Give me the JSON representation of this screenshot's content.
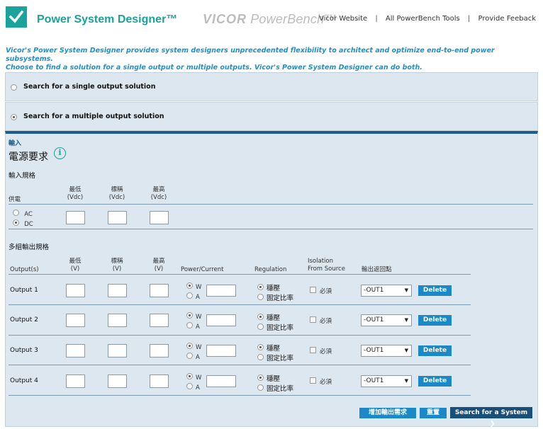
{
  "header": {
    "app_title": "Power System Designer™",
    "brand_logo_main": "VICOR",
    "brand_logo_sub": "PowerBench™",
    "links": [
      "Vicor Website",
      "All PowerBench Tools",
      "Provide Feeback"
    ],
    "separator": "|"
  },
  "intro": {
    "line1": "Vicor's Power System Designer provides system designers unprecedented flexibility to architect and optimize end-to-end power subsystems.",
    "line2": "Choose to find a solution for a single output or multiple outputs. Vicor's Power System Designer can do both."
  },
  "search_options": [
    {
      "label": "Search for a single output solution",
      "selected": false
    },
    {
      "label": "Search for a multiple output solution",
      "selected": true
    }
  ],
  "form": {
    "section_label": "輸入",
    "title": "電源要求",
    "info_icon_glyph": "i",
    "input_spec_label": "輸入規格",
    "supply_label": "供電",
    "input_columns": [
      {
        "name": "最低",
        "unit": "(Vdc)"
      },
      {
        "name": "標稱",
        "unit": "(Vdc)"
      },
      {
        "name": "最高",
        "unit": "(Vdc)"
      }
    ],
    "supply_options": [
      {
        "label": "AC",
        "selected": false
      },
      {
        "label": "DC",
        "selected": true
      }
    ],
    "multi_output_label": "多組輸出規格",
    "output_headers": {
      "outputs": "Output(s)",
      "min": {
        "name": "最低",
        "unit": "(V)"
      },
      "nom": {
        "name": "標稱",
        "unit": "(V)"
      },
      "max": {
        "name": "最高",
        "unit": "(V)"
      },
      "power_current": "Power/Current",
      "regulation": "Regulation",
      "isolation_line1": "Isolation",
      "isolation_line2": "From Source",
      "return_point": "輸出返回點"
    },
    "outputs": [
      {
        "label": "Output  1",
        "w_label": "W",
        "a_label": "A",
        "reg_opt1": "穩壓",
        "reg_opt2": "固定比率",
        "isolation_label": "必須",
        "return_value": "-OUT1",
        "delete_label": "Delete"
      },
      {
        "label": "Output  2",
        "w_label": "W",
        "a_label": "A",
        "reg_opt1": "穩壓",
        "reg_opt2": "固定比率",
        "isolation_label": "必須",
        "return_value": "-OUT1",
        "delete_label": "Delete"
      },
      {
        "label": "Output  3",
        "w_label": "W",
        "a_label": "A",
        "reg_opt1": "穩壓",
        "reg_opt2": "固定比率",
        "isolation_label": "必須",
        "return_value": "-OUT1",
        "delete_label": "Delete"
      },
      {
        "label": "Output  4",
        "w_label": "W",
        "a_label": "A",
        "reg_opt1": "穩壓",
        "reg_opt2": "固定比率",
        "isolation_label": "必須",
        "return_value": "-OUT1",
        "delete_label": "Delete"
      }
    ],
    "buttons": {
      "add_output": "增加輸出需求",
      "reset": "重置",
      "search_system": "Search for a System",
      "search_arrow": "❯"
    }
  },
  "colors": {
    "teal": "#1aa39a",
    "intro_blue": "#1b92c9",
    "panel_bg": "#dce7ef",
    "header_bar": "#1f5b8c",
    "button_blue": "#1b88c8",
    "button_dark": "#174f7d"
  }
}
